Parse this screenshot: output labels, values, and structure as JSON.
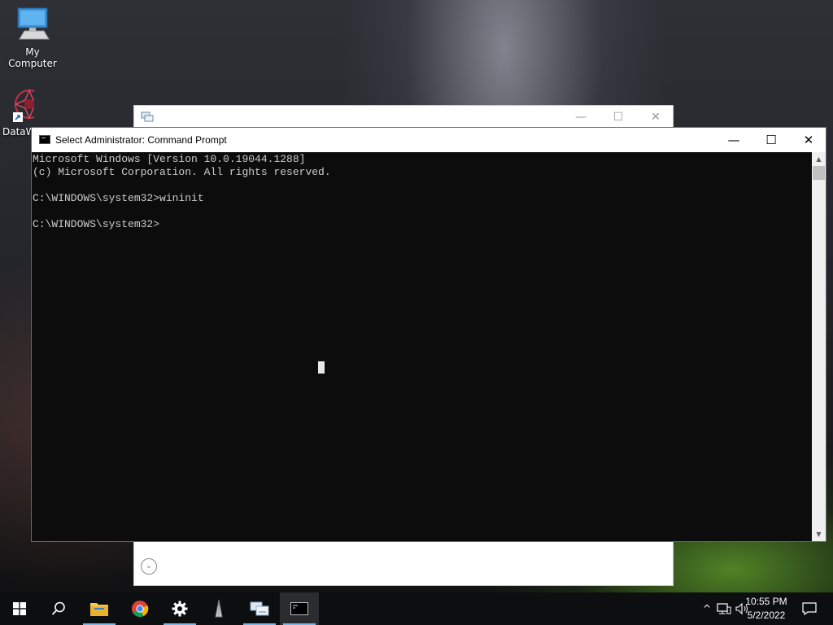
{
  "desktop": {
    "icons": [
      {
        "label": "My Computer",
        "icon": "computer-icon"
      },
      {
        "label": "DataW",
        "icon": "dataw-shortcut-icon"
      }
    ]
  },
  "background_window": {
    "icon": "network-window-icon",
    "controls": {
      "minimize": "—",
      "maximize": "☐",
      "close": "✕"
    },
    "expand_icon": "chevron-down-circle-icon",
    "expand_glyph": "⌄"
  },
  "cmd_window": {
    "title": "Select Administrator: Command Prompt",
    "controls": {
      "minimize": "—",
      "maximize": "☐",
      "close": "✕"
    },
    "lines": [
      "Microsoft Windows [Version 10.0.19044.1288]",
      "(c) Microsoft Corporation. All rights reserved.",
      "",
      "C:\\WINDOWS\\system32>wininit",
      "",
      "C:\\WINDOWS\\system32>"
    ],
    "colors": {
      "background": "#0c0c0c",
      "text": "#cccccc"
    },
    "scrollbar": {
      "up": "▲",
      "down": "▼"
    }
  },
  "taskbar": {
    "buttons": [
      {
        "name": "start-button",
        "icon": "windows-logo-icon"
      },
      {
        "name": "search-button",
        "icon": "search-icon"
      },
      {
        "name": "file-explorer-button",
        "icon": "folder-icon",
        "running": true
      },
      {
        "name": "chrome-button",
        "icon": "chrome-icon"
      },
      {
        "name": "settings-button",
        "icon": "gear-icon",
        "running": true
      },
      {
        "name": "app-button",
        "icon": "app-icon"
      },
      {
        "name": "network-app-button",
        "icon": "network-window-icon",
        "running": true
      },
      {
        "name": "command-prompt-button",
        "icon": "cmd-icon",
        "running": true,
        "active": true
      }
    ],
    "tray": {
      "chevron": "^",
      "icons": [
        "network-icon",
        "volume-icon"
      ],
      "time": "10:55 PM",
      "date": "5/2/2022",
      "notification_icon": "notification-icon"
    },
    "accent_color": "#76b9ed"
  }
}
